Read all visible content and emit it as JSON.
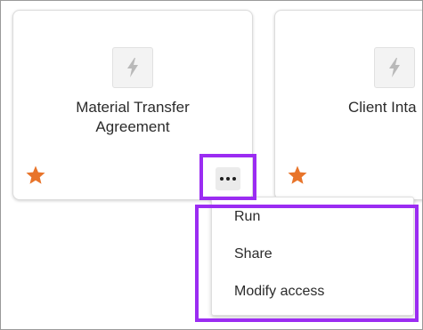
{
  "cards": [
    {
      "title_line1": "Material Transfer",
      "title_line2": "Agreement",
      "icon": "lightning-bolt-icon",
      "favorite": true
    },
    {
      "title_visible": "Client Inta",
      "icon": "lightning-bolt-icon",
      "favorite": true
    }
  ],
  "more_button": {
    "icon": "more-horizontal-icon"
  },
  "menu": {
    "items": [
      {
        "label": "Run"
      },
      {
        "label": "Share"
      },
      {
        "label": "Modify access"
      }
    ]
  },
  "colors": {
    "highlight": "#9b2cf2",
    "star": "#e8742a",
    "tile_icon": "#b9b9b9"
  }
}
